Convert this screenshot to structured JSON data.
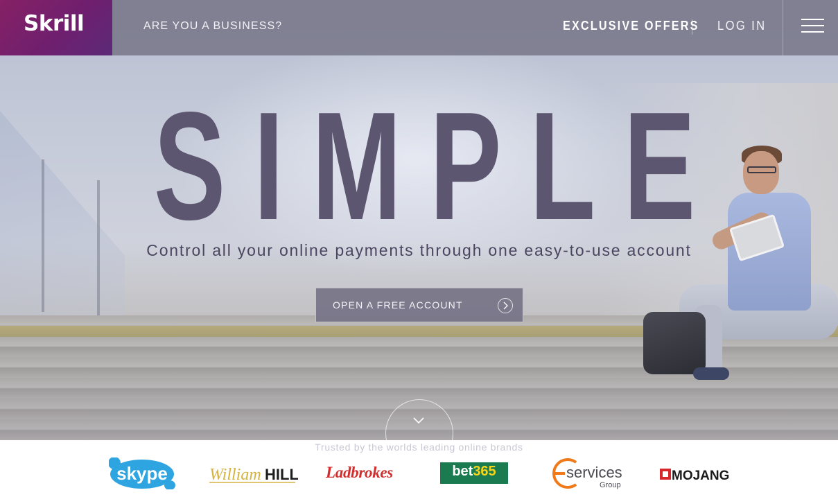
{
  "header": {
    "logo": "Skrill",
    "business_link": "ARE YOU A BUSINESS?",
    "offers_link": "EXCLUSIVE OFFERS",
    "login_link": "LOG IN",
    "menu_icon": "hamburger-menu-icon"
  },
  "hero": {
    "headline": "SIMPLE",
    "tagline": "Control all your online payments through one easy-to-use account",
    "cta_label": "OPEN A FREE ACCOUNT",
    "cta_icon": "chevron-right-circle-icon",
    "scroll_icon": "chevron-down-icon"
  },
  "trusted": {
    "label": "Trusted by the worlds leading online brands",
    "brands": [
      {
        "name": "skype"
      },
      {
        "name": "William",
        "name2": "HILL"
      },
      {
        "name": "Ladbrokes"
      },
      {
        "name": "bet",
        "name2": "365"
      },
      {
        "name": "services",
        "name2": "Group"
      },
      {
        "name": "MOJANG"
      }
    ]
  },
  "colors": {
    "brand_purple": "#862165",
    "headline": "#5d5670",
    "ladbrokes_red": "#d32c2c",
    "bet365_green": "#1a7a50",
    "bet365_yellow": "#f5d61a",
    "es_orange": "#f07a1a"
  }
}
